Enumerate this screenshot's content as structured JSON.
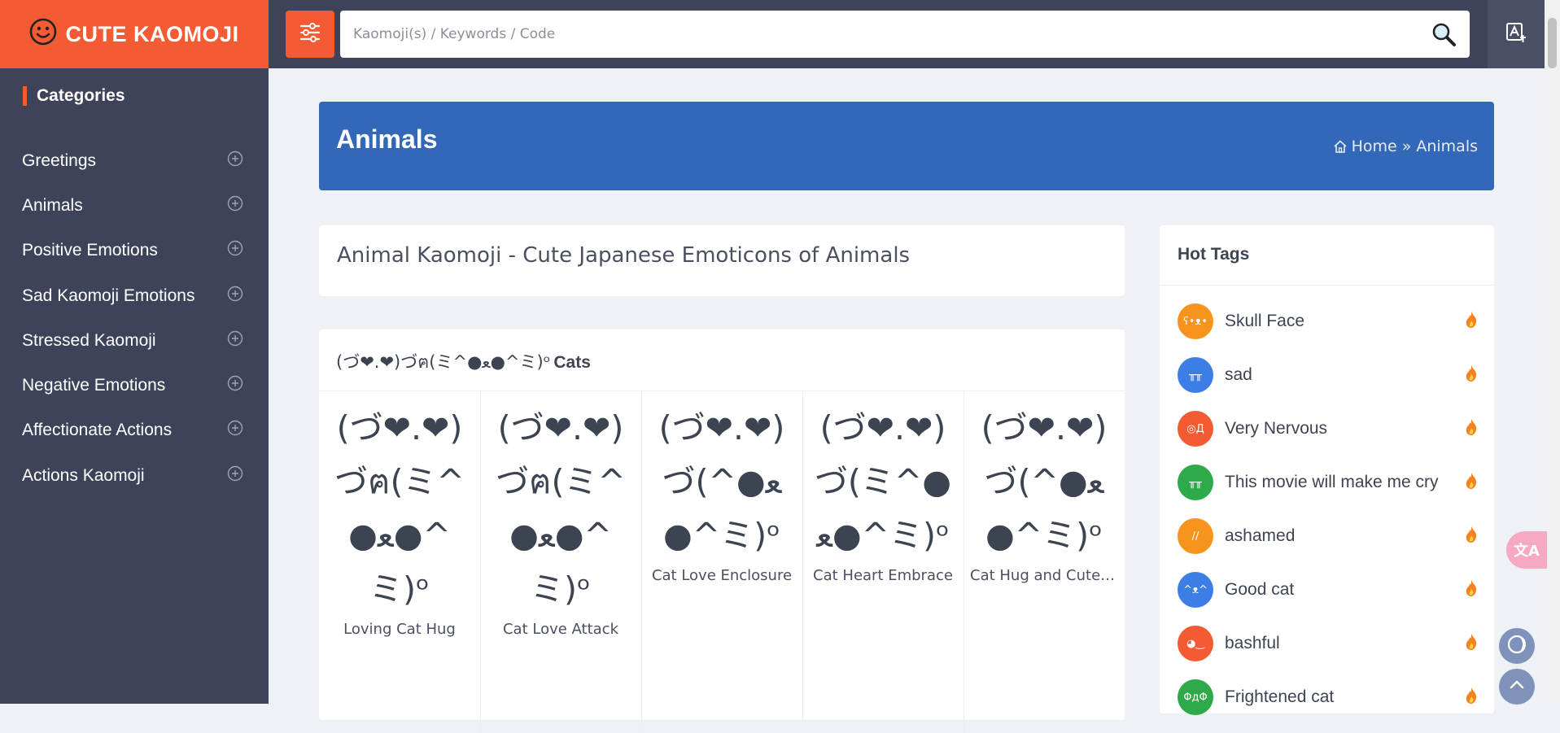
{
  "brand": {
    "name": "CUTE KAOMOJI",
    "smiley": "☺"
  },
  "search": {
    "placeholder": "Kaomoji(s) / Keywords / Code"
  },
  "sidebar": {
    "heading": "Categories",
    "items": [
      {
        "label": "Greetings"
      },
      {
        "label": "Animals"
      },
      {
        "label": "Positive Emotions"
      },
      {
        "label": "Sad Kaomoji Emotions"
      },
      {
        "label": "Stressed Kaomoji"
      },
      {
        "label": "Negative Emotions"
      },
      {
        "label": "Affectionate Actions"
      },
      {
        "label": "Actions Kaomoji"
      }
    ]
  },
  "banner": {
    "title": "Animals",
    "breadcrumb": {
      "home": "Home",
      "separator": "»",
      "current": "Animals"
    }
  },
  "intro": {
    "title": "Animal Kaomoji - Cute Japanese Emoticons of Animals"
  },
  "cats_section": {
    "kaomoji": "(づ❤.❤)づฅ(ミ^●ﻌ●^ミ)ᵒ",
    "title": "Cats",
    "items": [
      {
        "kaomoji": "(づ❤.❤)づฅ(ミ^●ﻌ●^ミ)ᵒ",
        "label": "Loving Cat Hug"
      },
      {
        "kaomoji": "(づ❤.❤)づฅ(ミ^●ﻌ●^ミ)ᵒ",
        "label": "Cat Love Attack"
      },
      {
        "kaomoji": "(づ❤.❤)づ(^●ﻌ●^ミ)ᵒ",
        "label": "Cat Love Enclosure"
      },
      {
        "kaomoji": "(づ❤.❤)づ(ミ^●ﻌ●^ミ)ᵒ",
        "label": "Cat Heart Embrace"
      },
      {
        "kaomoji": "(づ❤.❤)づ(^●ﻌ●^ミ)ᵒ",
        "label": "Cat Hug and Cute ..."
      }
    ]
  },
  "hot_tags": {
    "title": "Hot Tags",
    "items": [
      {
        "label": "Skull Face",
        "avatar_text": "ʕ•ᴥ•",
        "color": "#f7941d"
      },
      {
        "label": "sad",
        "avatar_text": "╥╥",
        "color": "#3d7ee6"
      },
      {
        "label": "Very Nervous",
        "avatar_text": "◎Д",
        "color": "#f45b33"
      },
      {
        "label": "This movie will make me cry",
        "avatar_text": "╥╥",
        "color": "#2eaa4a"
      },
      {
        "label": "ashamed",
        "avatar_text": "//",
        "color": "#f7941d"
      },
      {
        "label": "Good cat",
        "avatar_text": "^ᴥ^",
        "color": "#3d7ee6"
      },
      {
        "label": "bashful",
        "avatar_text": "◕‿",
        "color": "#f45b33"
      },
      {
        "label": "Frightened cat",
        "avatar_text": "ΦдΦ",
        "color": "#2eaa4a"
      }
    ]
  },
  "floating": {
    "translate_label": "文A"
  }
}
